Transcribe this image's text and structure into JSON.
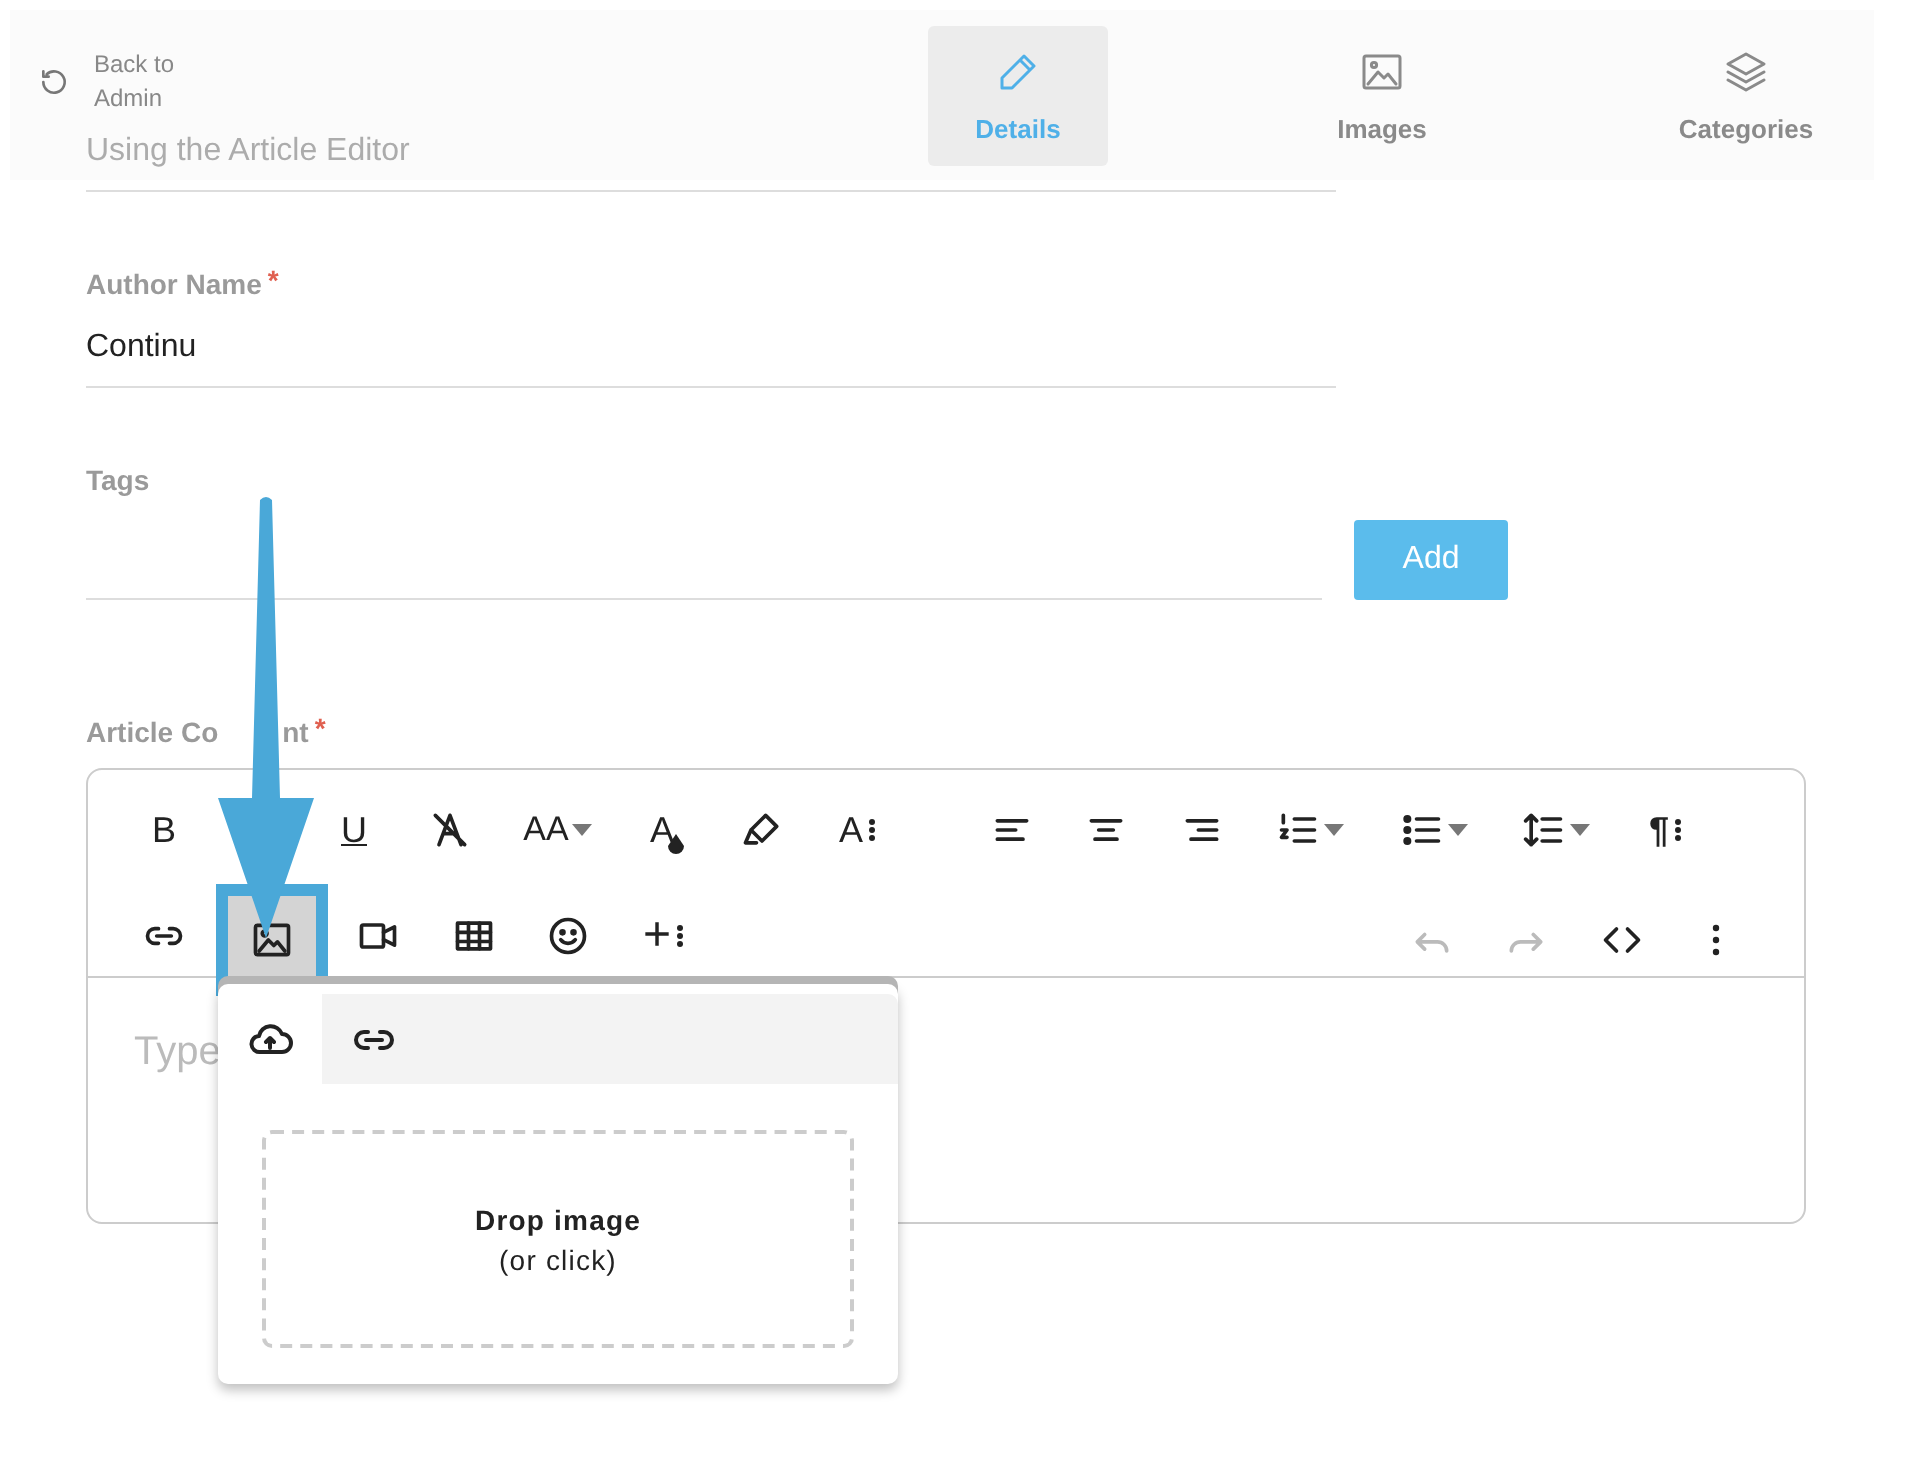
{
  "header": {
    "back_link": {
      "label": "Back to Admin"
    },
    "tabs": [
      {
        "label": "Details",
        "kind": "pencil",
        "selected": true
      },
      {
        "label": "Images",
        "kind": "image",
        "selected": false
      },
      {
        "label": "Categories",
        "kind": "layers",
        "selected": false
      }
    ]
  },
  "form": {
    "fields": [
      {
        "kind": "title",
        "value": "Using the Article Editor"
      },
      {
        "kind": "text",
        "label": "Author Name",
        "required_mark": "*",
        "value": "Continu"
      },
      {
        "kind": "tags",
        "label": "Tags",
        "button": "Add"
      }
    ],
    "content": {
      "label": "Article Co",
      "label_end": "nt",
      "required_mark": "*",
      "toolbar": [
        {
          "groups": [
            {
              "buttons": [
                {
                  "kind": "bold",
                  "label": "B",
                  "disabled": false,
                  "selected": false,
                  "dropdown": false
                },
                {
                  "kind": "underline",
                  "label": "U",
                  "disabled": false,
                  "selected": false,
                  "dropdown": false
                },
                {
                  "kind": "clear-format",
                  "disabled": false,
                  "selected": false,
                  "dropdown": false
                },
                {
                  "kind": "size",
                  "label": "AA",
                  "disabled": false,
                  "selected": false,
                  "dropdown": true
                },
                {
                  "kind": "color",
                  "label": "A",
                  "disabled": false,
                  "selected": false,
                  "dropdown": false
                },
                {
                  "kind": "highlight",
                  "disabled": false,
                  "selected": false,
                  "dropdown": false
                },
                {
                  "kind": "font",
                  "label": "A",
                  "disabled": false,
                  "selected": false,
                  "dropdown": false
                }
              ]
            },
            {
              "buttons": [
                {
                  "kind": "align-left",
                  "disabled": false,
                  "selected": false,
                  "dropdown": false
                },
                {
                  "kind": "align-center",
                  "disabled": false,
                  "selected": false,
                  "dropdown": false
                },
                {
                  "kind": "align-right",
                  "disabled": false,
                  "selected": false,
                  "dropdown": false
                },
                {
                  "kind": "ordered-list",
                  "disabled": false,
                  "selected": false,
                  "dropdown": true
                },
                {
                  "kind": "bullet-list",
                  "disabled": false,
                  "selected": false,
                  "dropdown": true
                },
                {
                  "kind": "line-height",
                  "disabled": false,
                  "selected": false,
                  "dropdown": true
                },
                {
                  "kind": "paragraph",
                  "label": "¶",
                  "disabled": false,
                  "selected": false,
                  "dropdown": false
                }
              ]
            }
          ]
        },
        {
          "groups": [
            {
              "buttons": [
                {
                  "kind": "link",
                  "disabled": false,
                  "selected": false,
                  "dropdown": false
                },
                {
                  "kind": "image",
                  "disabled": false,
                  "selected": true,
                  "dropdown": false
                },
                {
                  "kind": "video",
                  "disabled": false,
                  "selected": false,
                  "dropdown": false
                },
                {
                  "kind": "table",
                  "disabled": false,
                  "selected": false,
                  "dropdown": false
                },
                {
                  "kind": "emoji",
                  "disabled": false,
                  "selected": false,
                  "dropdown": false
                },
                {
                  "kind": "insert",
                  "label": "+",
                  "disabled": false,
                  "selected": false,
                  "dropdown": false
                }
              ]
            },
            {
              "buttons": [
                {
                  "kind": "undo",
                  "disabled": true,
                  "selected": false,
                  "dropdown": false
                },
                {
                  "kind": "redo",
                  "disabled": true,
                  "selected": false,
                  "dropdown": false
                },
                {
                  "kind": "code",
                  "disabled": false,
                  "selected": false,
                  "dropdown": false
                },
                {
                  "kind": "more",
                  "disabled": false,
                  "selected": false,
                  "dropdown": false
                }
              ]
            }
          ]
        }
      ],
      "placeholder": "Type",
      "popup": {
        "tabs": [
          {
            "kind": "upload",
            "selected": true
          },
          {
            "kind": "link",
            "selected": false
          }
        ],
        "dropzone": {
          "title": "Drop image",
          "hint": "(or click)"
        }
      }
    }
  },
  "callout_arrow": true
}
